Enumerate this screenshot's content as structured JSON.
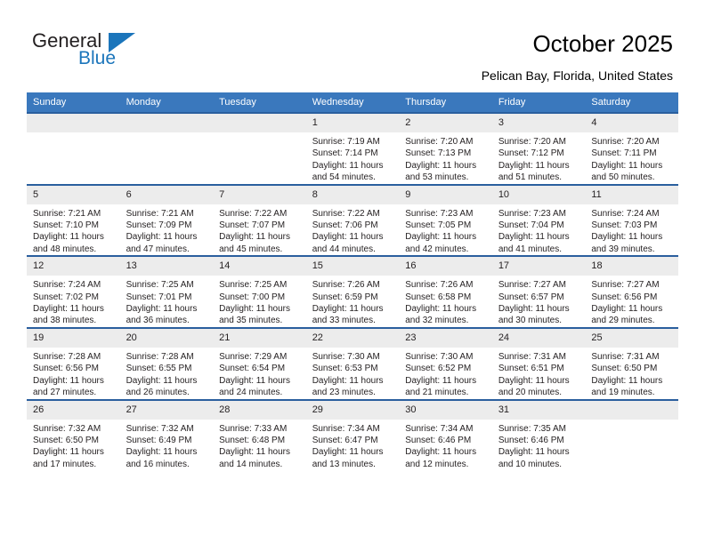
{
  "brand": {
    "name_part1": "General",
    "name_part2": "Blue"
  },
  "header": {
    "title": "October 2025",
    "subtitle": "Pelican Bay, Florida, United States"
  },
  "colors": {
    "header_blue": "#3a78bd",
    "row_rule_blue": "#2a5f9e",
    "daynum_grey": "#ececec",
    "brand_blue": "#1b75bb"
  },
  "weekdays": [
    "Sunday",
    "Monday",
    "Tuesday",
    "Wednesday",
    "Thursday",
    "Friday",
    "Saturday"
  ],
  "labels": {
    "sunrise_prefix": "Sunrise:",
    "sunset_prefix": "Sunset:",
    "daylight_prefix": "Daylight:"
  },
  "weeks": [
    [
      {
        "day": "",
        "sunrise": "",
        "sunset": "",
        "daylight_line1": "",
        "daylight_line2": ""
      },
      {
        "day": "",
        "sunrise": "",
        "sunset": "",
        "daylight_line1": "",
        "daylight_line2": ""
      },
      {
        "day": "",
        "sunrise": "",
        "sunset": "",
        "daylight_line1": "",
        "daylight_line2": ""
      },
      {
        "day": "1",
        "sunrise": "Sunrise: 7:19 AM",
        "sunset": "Sunset: 7:14 PM",
        "daylight_line1": "Daylight: 11 hours",
        "daylight_line2": "and 54 minutes."
      },
      {
        "day": "2",
        "sunrise": "Sunrise: 7:20 AM",
        "sunset": "Sunset: 7:13 PM",
        "daylight_line1": "Daylight: 11 hours",
        "daylight_line2": "and 53 minutes."
      },
      {
        "day": "3",
        "sunrise": "Sunrise: 7:20 AM",
        "sunset": "Sunset: 7:12 PM",
        "daylight_line1": "Daylight: 11 hours",
        "daylight_line2": "and 51 minutes."
      },
      {
        "day": "4",
        "sunrise": "Sunrise: 7:20 AM",
        "sunset": "Sunset: 7:11 PM",
        "daylight_line1": "Daylight: 11 hours",
        "daylight_line2": "and 50 minutes."
      }
    ],
    [
      {
        "day": "5",
        "sunrise": "Sunrise: 7:21 AM",
        "sunset": "Sunset: 7:10 PM",
        "daylight_line1": "Daylight: 11 hours",
        "daylight_line2": "and 48 minutes."
      },
      {
        "day": "6",
        "sunrise": "Sunrise: 7:21 AM",
        "sunset": "Sunset: 7:09 PM",
        "daylight_line1": "Daylight: 11 hours",
        "daylight_line2": "and 47 minutes."
      },
      {
        "day": "7",
        "sunrise": "Sunrise: 7:22 AM",
        "sunset": "Sunset: 7:07 PM",
        "daylight_line1": "Daylight: 11 hours",
        "daylight_line2": "and 45 minutes."
      },
      {
        "day": "8",
        "sunrise": "Sunrise: 7:22 AM",
        "sunset": "Sunset: 7:06 PM",
        "daylight_line1": "Daylight: 11 hours",
        "daylight_line2": "and 44 minutes."
      },
      {
        "day": "9",
        "sunrise": "Sunrise: 7:23 AM",
        "sunset": "Sunset: 7:05 PM",
        "daylight_line1": "Daylight: 11 hours",
        "daylight_line2": "and 42 minutes."
      },
      {
        "day": "10",
        "sunrise": "Sunrise: 7:23 AM",
        "sunset": "Sunset: 7:04 PM",
        "daylight_line1": "Daylight: 11 hours",
        "daylight_line2": "and 41 minutes."
      },
      {
        "day": "11",
        "sunrise": "Sunrise: 7:24 AM",
        "sunset": "Sunset: 7:03 PM",
        "daylight_line1": "Daylight: 11 hours",
        "daylight_line2": "and 39 minutes."
      }
    ],
    [
      {
        "day": "12",
        "sunrise": "Sunrise: 7:24 AM",
        "sunset": "Sunset: 7:02 PM",
        "daylight_line1": "Daylight: 11 hours",
        "daylight_line2": "and 38 minutes."
      },
      {
        "day": "13",
        "sunrise": "Sunrise: 7:25 AM",
        "sunset": "Sunset: 7:01 PM",
        "daylight_line1": "Daylight: 11 hours",
        "daylight_line2": "and 36 minutes."
      },
      {
        "day": "14",
        "sunrise": "Sunrise: 7:25 AM",
        "sunset": "Sunset: 7:00 PM",
        "daylight_line1": "Daylight: 11 hours",
        "daylight_line2": "and 35 minutes."
      },
      {
        "day": "15",
        "sunrise": "Sunrise: 7:26 AM",
        "sunset": "Sunset: 6:59 PM",
        "daylight_line1": "Daylight: 11 hours",
        "daylight_line2": "and 33 minutes."
      },
      {
        "day": "16",
        "sunrise": "Sunrise: 7:26 AM",
        "sunset": "Sunset: 6:58 PM",
        "daylight_line1": "Daylight: 11 hours",
        "daylight_line2": "and 32 minutes."
      },
      {
        "day": "17",
        "sunrise": "Sunrise: 7:27 AM",
        "sunset": "Sunset: 6:57 PM",
        "daylight_line1": "Daylight: 11 hours",
        "daylight_line2": "and 30 minutes."
      },
      {
        "day": "18",
        "sunrise": "Sunrise: 7:27 AM",
        "sunset": "Sunset: 6:56 PM",
        "daylight_line1": "Daylight: 11 hours",
        "daylight_line2": "and 29 minutes."
      }
    ],
    [
      {
        "day": "19",
        "sunrise": "Sunrise: 7:28 AM",
        "sunset": "Sunset: 6:56 PM",
        "daylight_line1": "Daylight: 11 hours",
        "daylight_line2": "and 27 minutes."
      },
      {
        "day": "20",
        "sunrise": "Sunrise: 7:28 AM",
        "sunset": "Sunset: 6:55 PM",
        "daylight_line1": "Daylight: 11 hours",
        "daylight_line2": "and 26 minutes."
      },
      {
        "day": "21",
        "sunrise": "Sunrise: 7:29 AM",
        "sunset": "Sunset: 6:54 PM",
        "daylight_line1": "Daylight: 11 hours",
        "daylight_line2": "and 24 minutes."
      },
      {
        "day": "22",
        "sunrise": "Sunrise: 7:30 AM",
        "sunset": "Sunset: 6:53 PM",
        "daylight_line1": "Daylight: 11 hours",
        "daylight_line2": "and 23 minutes."
      },
      {
        "day": "23",
        "sunrise": "Sunrise: 7:30 AM",
        "sunset": "Sunset: 6:52 PM",
        "daylight_line1": "Daylight: 11 hours",
        "daylight_line2": "and 21 minutes."
      },
      {
        "day": "24",
        "sunrise": "Sunrise: 7:31 AM",
        "sunset": "Sunset: 6:51 PM",
        "daylight_line1": "Daylight: 11 hours",
        "daylight_line2": "and 20 minutes."
      },
      {
        "day": "25",
        "sunrise": "Sunrise: 7:31 AM",
        "sunset": "Sunset: 6:50 PM",
        "daylight_line1": "Daylight: 11 hours",
        "daylight_line2": "and 19 minutes."
      }
    ],
    [
      {
        "day": "26",
        "sunrise": "Sunrise: 7:32 AM",
        "sunset": "Sunset: 6:50 PM",
        "daylight_line1": "Daylight: 11 hours",
        "daylight_line2": "and 17 minutes."
      },
      {
        "day": "27",
        "sunrise": "Sunrise: 7:32 AM",
        "sunset": "Sunset: 6:49 PM",
        "daylight_line1": "Daylight: 11 hours",
        "daylight_line2": "and 16 minutes."
      },
      {
        "day": "28",
        "sunrise": "Sunrise: 7:33 AM",
        "sunset": "Sunset: 6:48 PM",
        "daylight_line1": "Daylight: 11 hours",
        "daylight_line2": "and 14 minutes."
      },
      {
        "day": "29",
        "sunrise": "Sunrise: 7:34 AM",
        "sunset": "Sunset: 6:47 PM",
        "daylight_line1": "Daylight: 11 hours",
        "daylight_line2": "and 13 minutes."
      },
      {
        "day": "30",
        "sunrise": "Sunrise: 7:34 AM",
        "sunset": "Sunset: 6:46 PM",
        "daylight_line1": "Daylight: 11 hours",
        "daylight_line2": "and 12 minutes."
      },
      {
        "day": "31",
        "sunrise": "Sunrise: 7:35 AM",
        "sunset": "Sunset: 6:46 PM",
        "daylight_line1": "Daylight: 11 hours",
        "daylight_line2": "and 10 minutes."
      },
      {
        "day": "",
        "sunrise": "",
        "sunset": "",
        "daylight_line1": "",
        "daylight_line2": ""
      }
    ]
  ]
}
